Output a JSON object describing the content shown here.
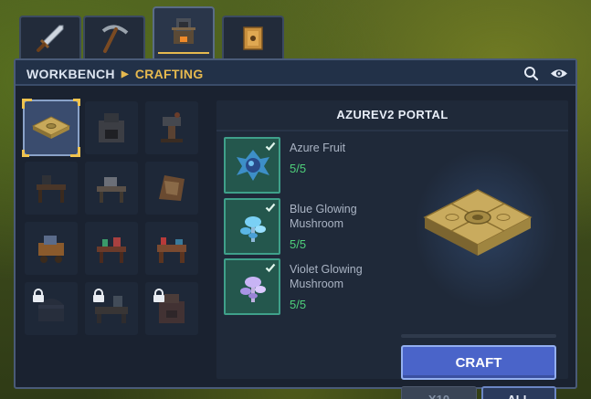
{
  "tabs": [
    {
      "name": "tools-tab",
      "icon": "sword-icon",
      "active": false
    },
    {
      "name": "pickaxe-tab",
      "icon": "pickaxe-icon",
      "active": false
    },
    {
      "name": "workbench-tab",
      "icon": "workbench-icon",
      "active": true
    },
    {
      "name": "box-tab",
      "icon": "crate-icon",
      "active": false
    }
  ],
  "header": {
    "root": "WORKBENCH",
    "current": "CRAFTING",
    "search_icon": "search-icon",
    "view_icon": "eye-icon"
  },
  "recipes": [
    {
      "name": "azurev2-portal",
      "selected": true,
      "locked": false
    },
    {
      "name": "furnace",
      "selected": false,
      "locked": false
    },
    {
      "name": "anvil-stand",
      "selected": false,
      "locked": false
    },
    {
      "name": "dark-workbench",
      "selected": false,
      "locked": false
    },
    {
      "name": "tool-bench",
      "selected": false,
      "locked": false
    },
    {
      "name": "tanning-rack",
      "selected": false,
      "locked": false
    },
    {
      "name": "cart-station",
      "selected": false,
      "locked": false
    },
    {
      "name": "alchemy-table",
      "selected": false,
      "locked": false
    },
    {
      "name": "crafting-desk",
      "selected": false,
      "locked": false
    },
    {
      "name": "locked-chest",
      "selected": false,
      "locked": true
    },
    {
      "name": "locked-bench",
      "selected": false,
      "locked": true
    },
    {
      "name": "locked-forge",
      "selected": false,
      "locked": true
    }
  ],
  "detail": {
    "title": "AZUREV2 PORTAL",
    "ingredients": [
      {
        "name": "Azure Fruit",
        "count": "5/5",
        "icon": "azure-fruit-icon"
      },
      {
        "name": "Blue Glowing Mushroom",
        "count": "5/5",
        "icon": "blue-mushroom-icon"
      },
      {
        "name": "Violet Glowing Mushroom",
        "count": "5/5",
        "icon": "violet-mushroom-icon"
      }
    ],
    "product_icon": "portal-tile-icon",
    "progress": 0,
    "craft_label": "CRAFT",
    "x10_label": "X10",
    "all_label": "ALL"
  },
  "colors": {
    "accent_gold": "#e6b94f",
    "craft_blue": "#4a64c9",
    "count_green": "#4fd17b",
    "ingredient_bg": "#24574d"
  }
}
